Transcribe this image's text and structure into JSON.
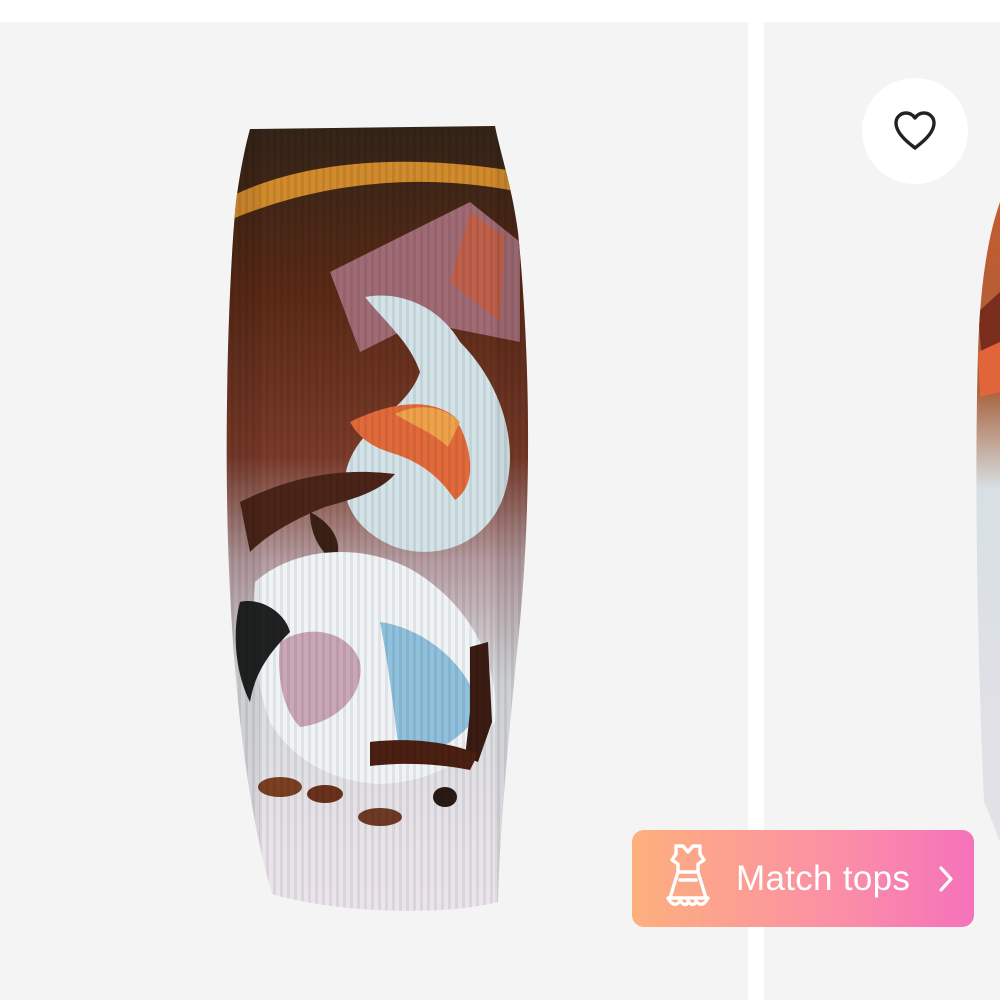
{
  "favorite": {
    "icon": "heart-outline-icon"
  },
  "match_tops": {
    "icon": "dress-icon",
    "label": "Match tops",
    "chevron_icon": "chevron-right-icon",
    "gradient_start": "#fdb07d",
    "gradient_end": "#f572bb"
  },
  "gallery": {
    "images": [
      {
        "alt": "product-image-skirt-front"
      },
      {
        "alt": "product-image-skirt-side"
      }
    ],
    "background": "#f4f4f5"
  }
}
